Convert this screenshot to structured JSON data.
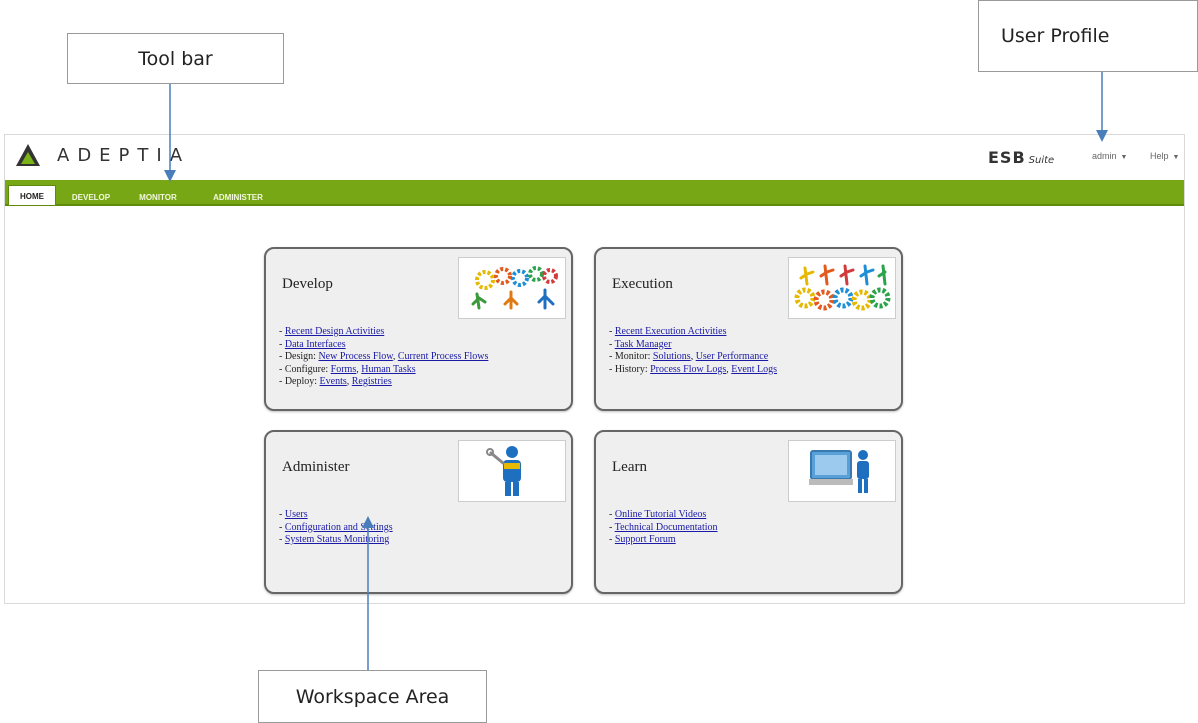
{
  "callouts": {
    "toolbar": "Tool bar",
    "user_profile": "User Profile",
    "workspace": "Workspace Area"
  },
  "header": {
    "logo_text": "ADEPTIA",
    "product_main": "ESB",
    "product_sub": "Suite",
    "user_menu": "admin",
    "help_menu": "Help"
  },
  "nav": {
    "tabs": [
      {
        "label": "HOME",
        "active": true
      },
      {
        "label": "DEVELOP",
        "active": false
      },
      {
        "label": "MONITOR",
        "active": false
      },
      {
        "label": "ADMINISTER",
        "active": false
      }
    ]
  },
  "cards": {
    "develop": {
      "title": "Develop",
      "lines": [
        {
          "prefix": "- ",
          "links": [
            "Recent Design Activities"
          ]
        },
        {
          "prefix": "- ",
          "links": [
            "Data Interfaces"
          ]
        },
        {
          "prefix": "- Design: ",
          "links": [
            "New Process Flow",
            "Current Process Flows"
          ]
        },
        {
          "prefix": "- Configure: ",
          "links": [
            "Forms",
            "Human Tasks"
          ]
        },
        {
          "prefix": "- Deploy: ",
          "links": [
            "Events",
            "Registries"
          ]
        }
      ]
    },
    "execution": {
      "title": "Execution",
      "lines": [
        {
          "prefix": "- ",
          "links": [
            "Recent Execution Activities"
          ]
        },
        {
          "prefix": "- ",
          "links": [
            "Task Manager"
          ]
        },
        {
          "prefix": "- Monitor: ",
          "links": [
            "Solutions",
            "User Performance"
          ]
        },
        {
          "prefix": "- History: ",
          "links": [
            "Process Flow Logs",
            "Event Logs"
          ]
        }
      ]
    },
    "administer": {
      "title": "Administer",
      "lines": [
        {
          "prefix": "- ",
          "links": [
            "Users"
          ]
        },
        {
          "prefix": "- ",
          "links": [
            "Configuration and Settings"
          ]
        },
        {
          "prefix": "- ",
          "links": [
            "System Status Monitoring"
          ]
        }
      ]
    },
    "learn": {
      "title": "Learn",
      "lines": [
        {
          "prefix": "- ",
          "links": [
            "Online Tutorial Videos"
          ]
        },
        {
          "prefix": "- ",
          "links": [
            "Technical Documentation"
          ]
        },
        {
          "prefix": "- ",
          "links": [
            "Support Forum"
          ]
        }
      ]
    }
  },
  "colors": {
    "nav_green": "#78a716",
    "link_blue": "#1a1aa6",
    "arrow_blue": "#4a7ebb"
  }
}
